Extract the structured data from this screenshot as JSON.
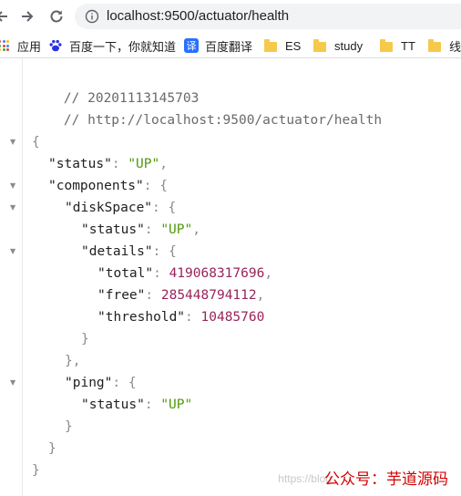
{
  "address_bar": {
    "url": "localhost:9500/actuator/health"
  },
  "bookmarks": [
    {
      "label": "应用",
      "icon": "apps-grid-icon"
    },
    {
      "label": "百度一下，你就知道",
      "icon": "baidu-paw-icon"
    },
    {
      "label": "百度翻译",
      "icon": "baidu-translate-icon",
      "glyph": "译"
    },
    {
      "label": "ES",
      "icon": "folder-icon"
    },
    {
      "label": "study",
      "icon": "folder-icon"
    },
    {
      "label": "TT",
      "icon": "folder-icon"
    },
    {
      "label": "线",
      "icon": "folder-icon"
    }
  ],
  "json_view": {
    "comments": [
      "// 20201113145703",
      "// http://localhost:9500/actuator/health"
    ],
    "keys": {
      "status": "\"status\"",
      "components": "\"components\"",
      "diskSpace": "\"diskSpace\"",
      "details": "\"details\"",
      "total": "\"total\"",
      "free": "\"free\"",
      "threshold": "\"threshold\"",
      "ping": "\"ping\""
    },
    "values": {
      "status": "\"UP\"",
      "disk_status": "\"UP\"",
      "total": "419068317696",
      "free": "285448794112",
      "threshold": "10485760",
      "ping_status": "\"UP\""
    }
  },
  "watermark": {
    "text": "公众号：芋道源码",
    "faint_text": "https://blog"
  },
  "colors": {
    "string": "#4e9a06",
    "number": "#99235a",
    "comment": "#6a6a6a",
    "watermark": "#d50000"
  }
}
